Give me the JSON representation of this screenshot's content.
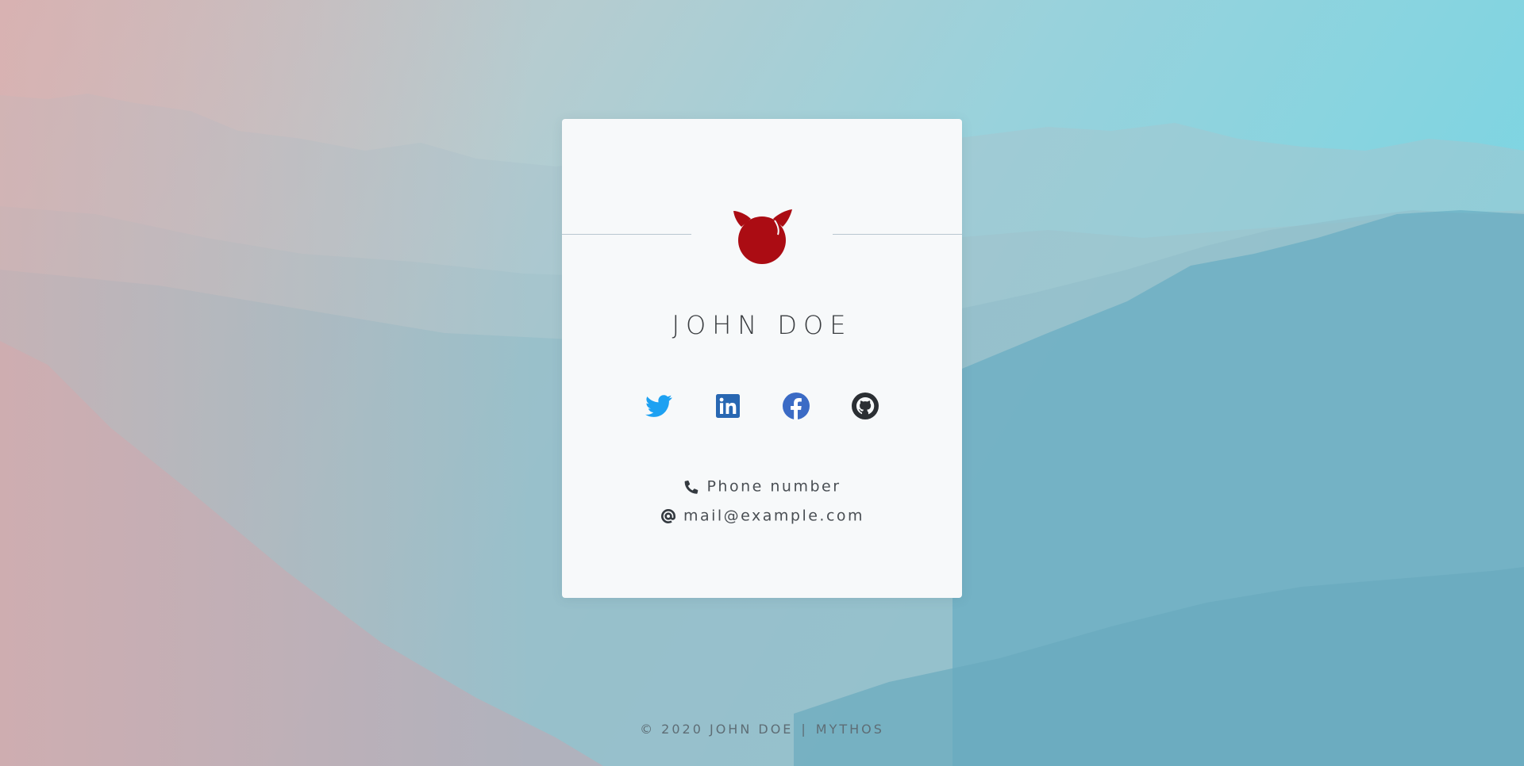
{
  "profile": {
    "name": "JOHN DOE",
    "logo_icon": "freebsd-daemon-icon",
    "logo_color": "#ab0c13"
  },
  "socials": [
    {
      "icon": "twitter-icon",
      "color": "#1da1f2"
    },
    {
      "icon": "linkedin-icon",
      "color": "#2867b2"
    },
    {
      "icon": "facebook-icon",
      "color": "#3b6bc5"
    },
    {
      "icon": "github-icon",
      "color": "#2b2f33"
    }
  ],
  "contact": {
    "phone_icon": "phone-icon",
    "phone": "Phone number",
    "email_icon": "at-sign-icon",
    "email": "mail@example.com"
  },
  "footer": {
    "copyright": "© 2020 JOHN DOE",
    "separator": "|",
    "brand": "MYTHOS"
  }
}
